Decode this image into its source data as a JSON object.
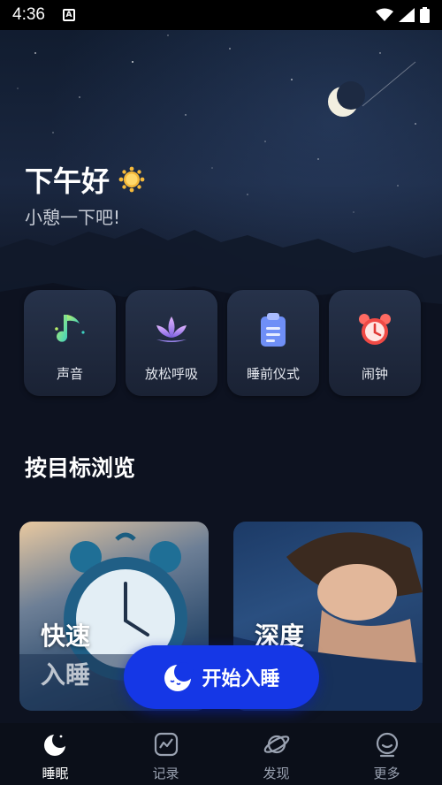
{
  "status_bar": {
    "time": "4:36",
    "indicator": "A"
  },
  "greeting": {
    "title": "下午好",
    "subtitle": "小憩一下吧!"
  },
  "quick_actions": [
    {
      "label": "声音",
      "icon": "music-note-icon"
    },
    {
      "label": "放松呼吸",
      "icon": "lotus-icon"
    },
    {
      "label": "睡前仪式",
      "icon": "clipboard-icon"
    },
    {
      "label": "闹钟",
      "icon": "alarm-clock-icon"
    }
  ],
  "browse": {
    "title": "按目标浏览",
    "cards": [
      {
        "title": "快速",
        "subtitle": "入睡"
      },
      {
        "title": "深度",
        "subtitle": ""
      }
    ]
  },
  "start_button": {
    "label": "开始入睡"
  },
  "nav": {
    "items": [
      {
        "label": "睡眠",
        "icon": "moon-icon",
        "active": true
      },
      {
        "label": "记录",
        "icon": "chart-icon",
        "active": false
      },
      {
        "label": "发现",
        "icon": "planet-icon",
        "active": false
      },
      {
        "label": "更多",
        "icon": "smile-icon",
        "active": false
      }
    ]
  },
  "colors": {
    "accent": "#1537e6",
    "background": "#0d1220"
  }
}
